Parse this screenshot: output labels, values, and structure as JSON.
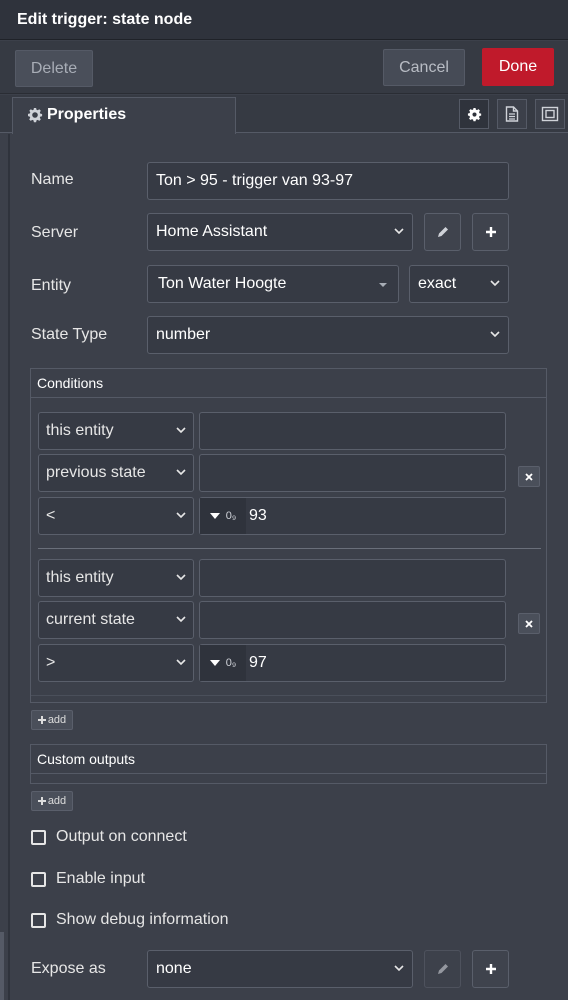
{
  "header": {
    "title": "Edit trigger: state node"
  },
  "toolbar": {
    "delete_label": "Delete",
    "cancel_label": "Cancel",
    "done_label": "Done"
  },
  "tabs": {
    "properties_label": "Properties"
  },
  "form": {
    "name_label": "Name",
    "name_value": "Ton > 95 - trigger van 93-97",
    "server_label": "Server",
    "server_value": "Home Assistant",
    "entity_label": "Entity",
    "entity_value": "Ton Water Hoogte",
    "entity_match": "exact",
    "state_type_label": "State Type",
    "state_type_value": "number"
  },
  "conditions": {
    "legend": "Conditions",
    "items": [
      {
        "rows": [
          {
            "select": "this entity",
            "value": ""
          },
          {
            "select": "previous state",
            "value": ""
          },
          {
            "select": "<",
            "type": "0₉",
            "value": "93"
          }
        ]
      },
      {
        "rows": [
          {
            "select": "this entity",
            "value": ""
          },
          {
            "select": "current state",
            "value": ""
          },
          {
            "select": ">",
            "type": "0₉",
            "value": "97"
          }
        ]
      }
    ],
    "add_label": "add"
  },
  "custom_outputs": {
    "legend": "Custom outputs",
    "add_label": "add"
  },
  "checkboxes": {
    "output_on_connect": "Output on connect",
    "enable_input": "Enable input",
    "show_debug": "Show debug information"
  },
  "expose": {
    "label": "Expose as",
    "value": "none"
  },
  "colors": {
    "accent": "#c01a2b",
    "background": "#3c404a",
    "input_bg": "#363a44"
  },
  "icons": {
    "tab_properties": "gear-icon",
    "tab_description": "document-icon",
    "tab_appearance": "frame-icon",
    "edit": "pencil-icon",
    "add": "plus-icon",
    "dropdown": "chevron-down-icon",
    "remove": "close-icon",
    "type_toggle": "caret-down-icon"
  }
}
